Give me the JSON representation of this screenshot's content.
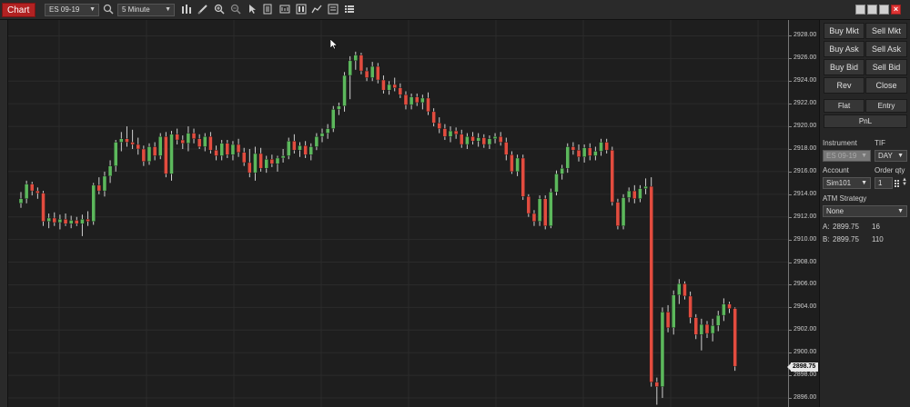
{
  "toolbar": {
    "chart_tab_label": "Chart",
    "instrument_select": "ES 09-19",
    "interval_select": "5 Minute",
    "icons": [
      "search-icon",
      "bar-type-icon",
      "draw-pencil-icon",
      "zoom-in-icon",
      "zoom-out-icon",
      "pointer-icon",
      "data-box-icon",
      "properties-icon",
      "indicators-icon",
      "strategies-icon",
      "chart-trader-icon",
      "list-icon"
    ]
  },
  "price_axis": {
    "ticks": [
      "2928.00",
      "2926.00",
      "2924.00",
      "2922.00",
      "2920.00",
      "2918.00",
      "2916.00",
      "2914.00",
      "2912.00",
      "2910.00",
      "2908.00",
      "2906.00",
      "2904.00",
      "2902.00",
      "2900.00",
      "2898.00",
      "2896.00"
    ],
    "last_price": "2898.75"
  },
  "order_panel": {
    "buy_mkt": "Buy Mkt",
    "sell_mkt": "Sell Mkt",
    "buy_ask": "Buy Ask",
    "sell_ask": "Sell Ask",
    "buy_bid": "Buy Bid",
    "sell_bid": "Sell Bid",
    "rev": "Rev",
    "close": "Close",
    "flat": "Flat",
    "entry": "Entry",
    "pnl": "PnL",
    "instrument_label": "Instrument",
    "tif_label": "TIF",
    "instrument_value": "ES 09-19",
    "tif_value": "DAY",
    "account_label": "Account",
    "order_qty_label": "Order qty",
    "account_value": "Sim101",
    "order_qty_value": "1",
    "atm_label": "ATM Strategy",
    "atm_value": "None",
    "ask_label": "A:",
    "ask_price": "2899.75",
    "ask_size": "16",
    "bid_label": "B:",
    "bid_price": "2899.75",
    "bid_size": "110"
  },
  "colors": {
    "up": "#5cb85c",
    "down": "#e24c3f",
    "chart_bg": "#1e1e1e",
    "grid": "#2b2b2b"
  },
  "chart_data": {
    "type": "candlestick",
    "ylim": [
      2895.2,
      2929.4
    ],
    "candles": [
      [
        2913.2,
        2914.2,
        2912.8,
        2913.6
      ],
      [
        2913.6,
        2915.2,
        2913.2,
        2914.9
      ],
      [
        2914.9,
        2915.1,
        2913.9,
        2914.3
      ],
      [
        2914.3,
        2914.6,
        2913.6,
        2914.1
      ],
      [
        2914.1,
        2914.3,
        2911.2,
        2911.6
      ],
      [
        2911.6,
        2912.3,
        2911.0,
        2911.9
      ],
      [
        2911.9,
        2912.4,
        2911.2,
        2911.5
      ],
      [
        2911.5,
        2912.2,
        2910.9,
        2911.8
      ],
      [
        2911.8,
        2912.3,
        2911.2,
        2911.4
      ],
      [
        2911.4,
        2912.1,
        2911.0,
        2911.7
      ],
      [
        2911.7,
        2912.0,
        2911.2,
        2911.4
      ],
      [
        2911.4,
        2912.2,
        2910.3,
        2911.8
      ],
      [
        2911.8,
        2912.5,
        2911.2,
        2911.6
      ],
      [
        2911.6,
        2915.0,
        2911.3,
        2914.8
      ],
      [
        2914.8,
        2915.5,
        2914.0,
        2914.3
      ],
      [
        2914.3,
        2916.0,
        2913.8,
        2915.6
      ],
      [
        2915.6,
        2917.0,
        2915.0,
        2916.5
      ],
      [
        2916.5,
        2918.8,
        2916.0,
        2918.6
      ],
      [
        2918.6,
        2919.5,
        2917.8,
        2918.9
      ],
      [
        2918.9,
        2920.0,
        2918.2,
        2918.6
      ],
      [
        2918.6,
        2919.7,
        2918.0,
        2918.4
      ],
      [
        2918.4,
        2919.0,
        2917.5,
        2918.0
      ],
      [
        2918.0,
        2918.3,
        2916.5,
        2916.9
      ],
      [
        2916.9,
        2918.5,
        2916.6,
        2918.2
      ],
      [
        2918.2,
        2918.6,
        2917.0,
        2917.4
      ],
      [
        2917.4,
        2919.4,
        2917.1,
        2919.1
      ],
      [
        2919.1,
        2919.5,
        2915.5,
        2915.8
      ],
      [
        2915.8,
        2919.6,
        2915.2,
        2919.3
      ],
      [
        2919.3,
        2919.8,
        2918.4,
        2918.8
      ],
      [
        2918.8,
        2919.2,
        2918.0,
        2918.5
      ],
      [
        2918.5,
        2920.0,
        2917.8,
        2919.4
      ],
      [
        2919.4,
        2919.8,
        2918.5,
        2918.9
      ],
      [
        2918.9,
        2919.3,
        2918.0,
        2918.2
      ],
      [
        2918.2,
        2919.4,
        2917.8,
        2919.1
      ],
      [
        2919.1,
        2919.5,
        2917.6,
        2917.9
      ],
      [
        2917.9,
        2918.3,
        2917.0,
        2917.4
      ],
      [
        2917.4,
        2918.8,
        2917.0,
        2918.5
      ],
      [
        2918.5,
        2918.8,
        2917.2,
        2917.5
      ],
      [
        2917.5,
        2918.7,
        2917.0,
        2918.4
      ],
      [
        2918.4,
        2918.9,
        2917.3,
        2917.7
      ],
      [
        2917.7,
        2918.1,
        2916.5,
        2916.8
      ],
      [
        2916.8,
        2918.0,
        2915.5,
        2915.9
      ],
      [
        2915.9,
        2918.2,
        2915.2,
        2917.6
      ],
      [
        2917.6,
        2918.1,
        2916.0,
        2916.3
      ],
      [
        2916.3,
        2917.4,
        2915.9,
        2917.1
      ],
      [
        2917.1,
        2917.5,
        2916.4,
        2916.7
      ],
      [
        2916.7,
        2917.4,
        2916.0,
        2917.2
      ],
      [
        2917.2,
        2918.0,
        2916.8,
        2917.4
      ],
      [
        2917.4,
        2919.0,
        2917.1,
        2918.7
      ],
      [
        2918.7,
        2919.3,
        2917.6,
        2917.9
      ],
      [
        2917.9,
        2918.6,
        2917.3,
        2918.3
      ],
      [
        2918.3,
        2918.7,
        2917.2,
        2917.5
      ],
      [
        2917.5,
        2918.5,
        2917.0,
        2918.2
      ],
      [
        2918.2,
        2919.4,
        2917.9,
        2919.1
      ],
      [
        2919.1,
        2919.8,
        2918.6,
        2919.4
      ],
      [
        2919.4,
        2920.2,
        2918.9,
        2919.8
      ],
      [
        2919.8,
        2921.8,
        2919.5,
        2921.5
      ],
      [
        2921.5,
        2922.1,
        2921.0,
        2921.8
      ],
      [
        2921.8,
        2924.8,
        2921.3,
        2924.5
      ],
      [
        2924.5,
        2926.2,
        2922.4,
        2925.8
      ],
      [
        2925.8,
        2926.6,
        2925.0,
        2926.3
      ],
      [
        2926.3,
        2926.5,
        2924.6,
        2924.9
      ],
      [
        2924.9,
        2925.2,
        2924.0,
        2924.3
      ],
      [
        2924.3,
        2925.7,
        2924.0,
        2925.3
      ],
      [
        2925.3,
        2925.6,
        2923.8,
        2924.1
      ],
      [
        2924.1,
        2924.5,
        2922.9,
        2923.2
      ],
      [
        2923.2,
        2924.0,
        2922.8,
        2923.7
      ],
      [
        2923.7,
        2924.3,
        2923.1,
        2923.4
      ],
      [
        2923.4,
        2923.8,
        2922.5,
        2922.8
      ],
      [
        2922.8,
        2923.1,
        2921.5,
        2921.9
      ],
      [
        2921.9,
        2922.9,
        2921.5,
        2922.6
      ],
      [
        2922.6,
        2922.9,
        2921.8,
        2922.1
      ],
      [
        2922.1,
        2922.8,
        2921.5,
        2922.5
      ],
      [
        2922.5,
        2923.0,
        2921.0,
        2921.3
      ],
      [
        2921.3,
        2921.6,
        2920.0,
        2920.3
      ],
      [
        2920.3,
        2920.8,
        2919.4,
        2919.8
      ],
      [
        2919.8,
        2920.2,
        2918.8,
        2919.1
      ],
      [
        2919.1,
        2920.0,
        2918.6,
        2919.6
      ],
      [
        2919.6,
        2919.9,
        2918.9,
        2919.3
      ],
      [
        2919.3,
        2919.7,
        2918.1,
        2918.4
      ],
      [
        2918.4,
        2919.4,
        2918.0,
        2919.1
      ],
      [
        2919.1,
        2919.5,
        2918.4,
        2918.7
      ],
      [
        2918.7,
        2919.4,
        2918.2,
        2919.0
      ],
      [
        2919.0,
        2919.3,
        2918.1,
        2918.4
      ],
      [
        2918.4,
        2919.2,
        2918.0,
        2918.9
      ],
      [
        2918.9,
        2919.4,
        2918.5,
        2919.1
      ],
      [
        2919.1,
        2919.5,
        2918.3,
        2918.6
      ],
      [
        2918.6,
        2919.0,
        2917.0,
        2917.5
      ],
      [
        2917.5,
        2917.8,
        2915.8,
        2916.0
      ],
      [
        2916.0,
        2917.5,
        2915.6,
        2917.2
      ],
      [
        2917.2,
        2917.5,
        2913.5,
        2913.8
      ],
      [
        2913.8,
        2914.0,
        2912.0,
        2912.3
      ],
      [
        2912.3,
        2912.6,
        2911.2,
        2911.6
      ],
      [
        2911.6,
        2913.9,
        2911.2,
        2913.6
      ],
      [
        2913.6,
        2913.9,
        2910.9,
        2911.2
      ],
      [
        2911.2,
        2914.5,
        2911.0,
        2914.2
      ],
      [
        2914.2,
        2916.1,
        2913.9,
        2915.8
      ],
      [
        2915.8,
        2916.6,
        2915.3,
        2916.3
      ],
      [
        2916.3,
        2918.5,
        2915.9,
        2918.2
      ],
      [
        2918.2,
        2918.6,
        2917.5,
        2917.9
      ],
      [
        2917.9,
        2918.4,
        2916.9,
        2917.3
      ],
      [
        2917.3,
        2918.4,
        2916.8,
        2918.1
      ],
      [
        2918.1,
        2918.5,
        2917.0,
        2917.4
      ],
      [
        2917.4,
        2918.2,
        2917.0,
        2917.8
      ],
      [
        2917.8,
        2918.9,
        2917.4,
        2918.6
      ],
      [
        2918.6,
        2918.9,
        2917.6,
        2917.9
      ],
      [
        2917.9,
        2918.2,
        2913.0,
        2913.3
      ],
      [
        2913.3,
        2913.6,
        2910.9,
        2911.2
      ],
      [
        2911.2,
        2914.0,
        2910.9,
        2913.7
      ],
      [
        2913.7,
        2914.6,
        2913.3,
        2914.3
      ],
      [
        2914.3,
        2914.8,
        2913.2,
        2913.6
      ],
      [
        2913.6,
        2914.8,
        2913.3,
        2914.5
      ],
      [
        2914.5,
        2915.4,
        2914.0,
        2914.7
      ],
      [
        2914.7,
        2915.5,
        2897.0,
        2897.4
      ],
      [
        2897.4,
        2897.8,
        2895.4,
        2897.0
      ],
      [
        2897.0,
        2904.0,
        2896.0,
        2903.6
      ],
      [
        2903.6,
        2904.2,
        2901.8,
        2902.2
      ],
      [
        2902.2,
        2905.5,
        2901.6,
        2905.1
      ],
      [
        2905.1,
        2906.5,
        2904.3,
        2906.1
      ],
      [
        2906.1,
        2906.3,
        2904.7,
        2905.0
      ],
      [
        2905.0,
        2905.4,
        2902.6,
        2903.1
      ],
      [
        2903.1,
        2903.4,
        2901.2,
        2901.6
      ],
      [
        2901.6,
        2903.0,
        2900.2,
        2902.5
      ],
      [
        2902.5,
        2902.8,
        2901.3,
        2901.7
      ],
      [
        2901.7,
        2903.0,
        2901.0,
        2902.4
      ],
      [
        2902.4,
        2903.7,
        2901.9,
        2903.3
      ],
      [
        2903.3,
        2904.8,
        2902.8,
        2904.3
      ],
      [
        2904.3,
        2904.5,
        2903.5,
        2903.9
      ],
      [
        2903.9,
        2904.0,
        2898.4,
        2898.8
      ]
    ]
  }
}
